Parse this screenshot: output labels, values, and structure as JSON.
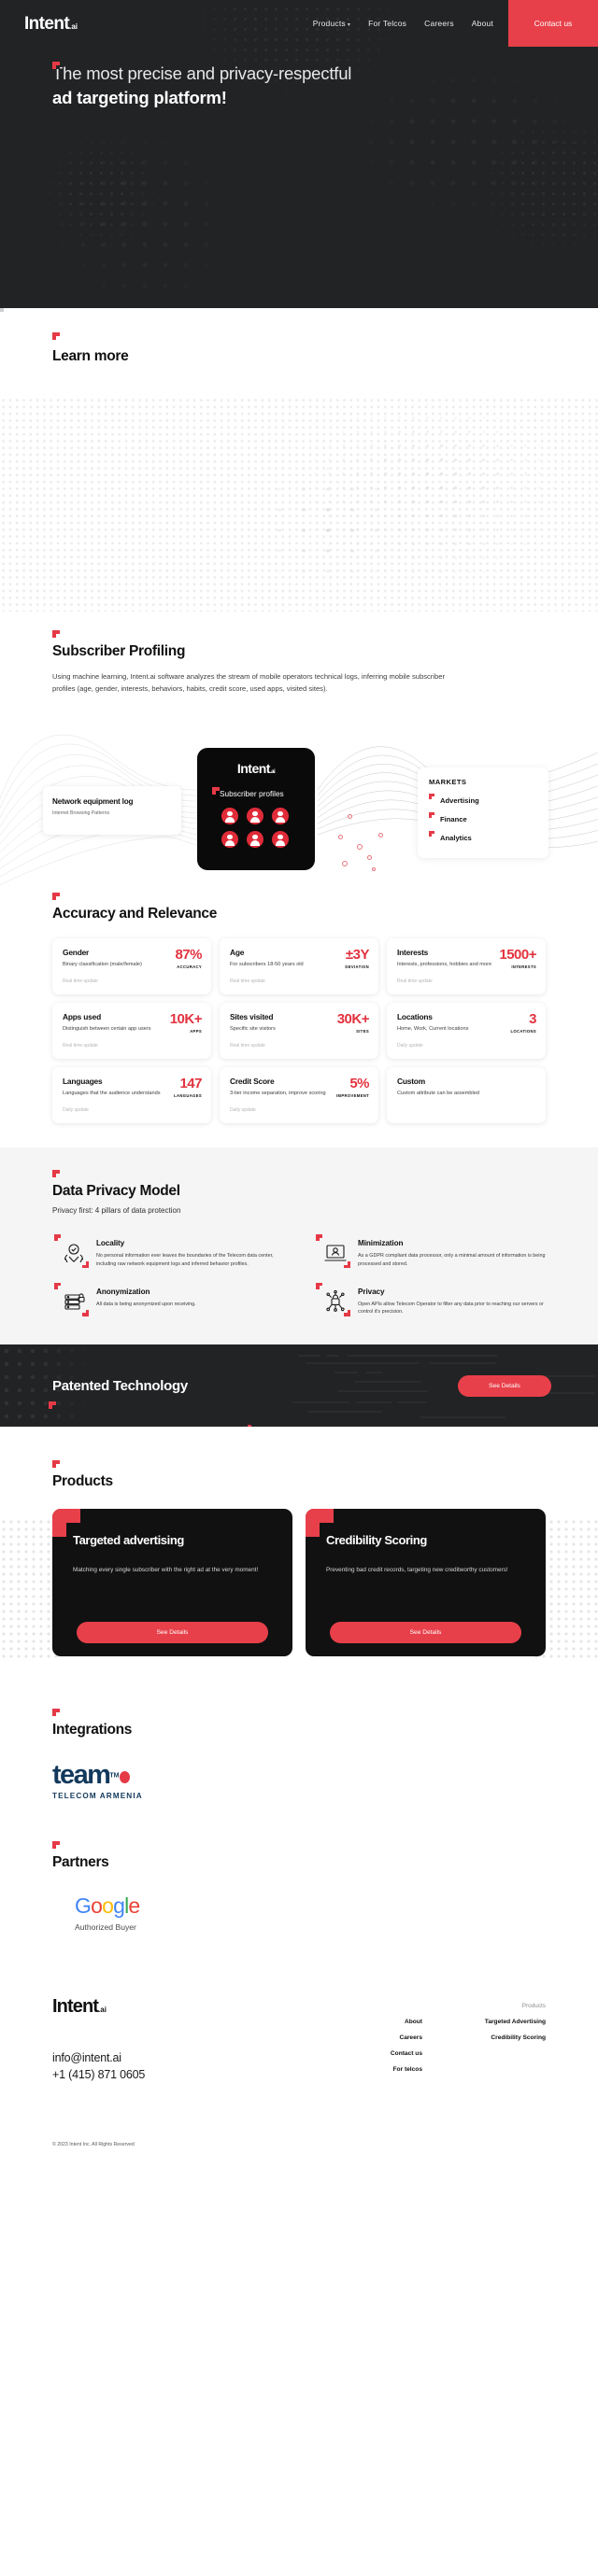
{
  "brand": {
    "name": "Intent",
    "suffix": ".ai",
    "accent": "#e8404a",
    "dark": "#222325"
  },
  "nav": {
    "logo": "Intent",
    "logo_suffix": ".ai",
    "links": [
      {
        "label": "Products",
        "has_caret": true
      },
      {
        "label": "For Telcos",
        "has_caret": false
      },
      {
        "label": "Careers",
        "has_caret": false
      },
      {
        "label": "About",
        "has_caret": false
      }
    ],
    "cta": "Contact us"
  },
  "hero": {
    "line1": "The most precise and privacy-respectful",
    "line2": "ad targeting platform!"
  },
  "learn_more": {
    "title": "Learn more"
  },
  "subscriber": {
    "title": "Subscriber Profiling",
    "body": "Using machine learning, Intent.ai software analyzes the stream of mobile operators technical logs, inferring mobile subscriber profiles (age, gender, interests, behaviors, habits, credit score, used apps, visited sites)."
  },
  "diagram": {
    "network_card": {
      "title": "Network equipment log",
      "subtitle": "Internet Browsing Patterns"
    },
    "center_card": {
      "logo": "Intent",
      "logo_suffix": ".ai",
      "label": "Subscriber profiles"
    },
    "markets_card": {
      "heading": "MARKETS",
      "items": [
        "Advertising",
        "Finance",
        "Analytics"
      ]
    }
  },
  "accuracy": {
    "title": "Accuracy and Relevance",
    "cards": [
      {
        "title": "Gender",
        "desc": "Binary classification (male/female)",
        "value": "87%",
        "unit": "ACCURACY",
        "update": "Real time update"
      },
      {
        "title": "Age",
        "desc": "For subscribers 18-50 years old",
        "value": "±3Y",
        "unit": "DEVIATION",
        "update": "Real time update"
      },
      {
        "title": "Interests",
        "desc": "Interests, professions, hobbies and more",
        "value": "1500+",
        "unit": "INTERESTS",
        "update": "Real time update"
      },
      {
        "title": "Apps used",
        "desc": "Distinguish between certain app users",
        "value": "10K+",
        "unit": "APPS",
        "update": "Real time update"
      },
      {
        "title": "Sites visited",
        "desc": "Specific site visitors",
        "value": "30K+",
        "unit": "SITES",
        "update": "Real time update"
      },
      {
        "title": "Locations",
        "desc": "Home, Work, Current locations",
        "value": "3",
        "unit": "LOCATIONS",
        "update": "Daily update"
      },
      {
        "title": "Languages",
        "desc": "Languages that the audience understands",
        "value": "147",
        "unit": "LANGUAGES",
        "update": "Daily update"
      },
      {
        "title": "Credit Score",
        "desc": "3-tier income separation, improve scoring",
        "value": "5%",
        "unit": "IMPROVEMENT",
        "update": "Daily update"
      },
      {
        "title": "Custom",
        "desc": "Custom attribute can be assembled",
        "value": "",
        "unit": "",
        "update": ""
      }
    ]
  },
  "privacy": {
    "title": "Data Privacy Model",
    "subtitle": "Privacy first: 4 pillars of data protection",
    "pillars": [
      {
        "icon": "hands-shield-icon",
        "title": "Locality",
        "desc": "No personal information ever leaves the boundaries of the Telecom data center, including raw network equipment logs and inferred behavior profiles."
      },
      {
        "icon": "laptop-user-icon",
        "title": "Minimization",
        "desc": "As a GDPR compliant data processor, only a minimal amount of information is being processed and stored."
      },
      {
        "icon": "server-lock-icon",
        "title": "Anonymization",
        "desc": "All data is being anonymized upon receiving."
      },
      {
        "icon": "network-lock-icon",
        "title": "Privacy",
        "desc": "Open APIs allow Telecom Operator to filter any data prior to reaching our servers or control it's precision."
      }
    ]
  },
  "patented": {
    "title": "Patented Technology",
    "button": "See Details"
  },
  "products": {
    "title": "Products",
    "cards": [
      {
        "title": "Targeted advertising",
        "desc": "Matching every single subscriber with the right ad at the very moment!",
        "button": "See Details"
      },
      {
        "title": "Credibility Scoring",
        "desc": "Preventing bad credit records, targeting new creditworthy customers!",
        "button": "See Details"
      }
    ]
  },
  "integrations": {
    "title": "Integrations",
    "logo": {
      "word": "team",
      "tm": "TM",
      "subtitle": "TELECOM ARMENIA"
    }
  },
  "partners": {
    "title": "Partners",
    "logo": {
      "letters": [
        "G",
        "o",
        "o",
        "g",
        "l",
        "e"
      ],
      "caption": "Authorized Buyer"
    }
  },
  "footer": {
    "logo": "Intent",
    "logo_suffix": ".ai",
    "email": "info@intent.ai",
    "phone": "+1 (415) 871 0605",
    "col1": {
      "head": "",
      "links": [
        "About",
        "Careers",
        "Contact us",
        "For telcos"
      ]
    },
    "col2": {
      "head": "Products",
      "links": [
        "Targeted Advertising",
        "Credibility Scoring"
      ]
    },
    "copyright": "© 2023 Intent Inc. All Rights Reserved"
  }
}
